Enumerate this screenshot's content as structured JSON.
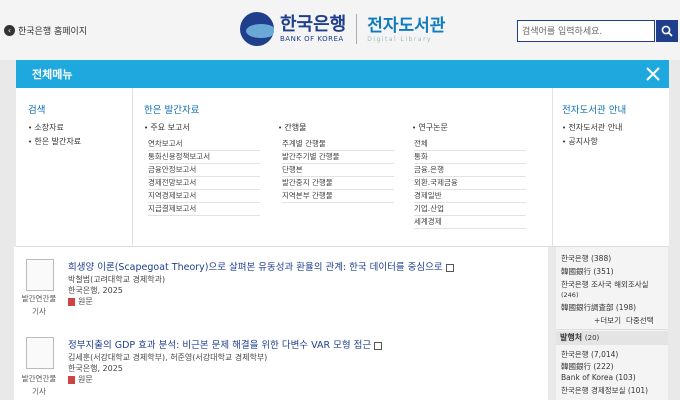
{
  "header": {
    "home_link": "한국은행 홈페이지",
    "logo_ko": "한국은행",
    "logo_en": "BANK OF KOREA",
    "library_ko": "전자도서관",
    "library_en": "Digital Library",
    "search_placeholder": "검색어를 입력하세요."
  },
  "menu": {
    "title": "전체메뉴",
    "search": {
      "title": "검색",
      "items": [
        "소장자료",
        "한은 발간자료"
      ]
    },
    "publications": {
      "title": "한은 발간자료",
      "groups": [
        {
          "label": "주요 보고서",
          "items": [
            "연차보고서",
            "통화신용정책보고서",
            "금융안정보고서",
            "경제전망보고서",
            "지역경제보고서",
            "지급결제보고서"
          ]
        },
        {
          "label": "간행물",
          "items": [
            "주계별 간행물",
            "발간주기별 간행물",
            "단행본",
            "발간중지 간행물",
            "지역본부 간행물"
          ]
        },
        {
          "label": "연구논문",
          "items": [
            "전체",
            "통화",
            "금융.은행",
            "외환.국제금융",
            "경제일반",
            "기업.산업",
            "세계경제"
          ]
        }
      ]
    },
    "library_info": {
      "title": "전자도서관 안내",
      "items": [
        "전자도서관 안내",
        "공지사항"
      ]
    }
  },
  "results": [
    {
      "thumb_label_1": "발간연간물",
      "thumb_label_2": "기사",
      "title": "희생양 이론(Scapegoat Theory)으로 살펴본 유동성과 환율의 관계: 한국 데이터를 중심으로",
      "authors": "박철범(고려대학교 경제학과)",
      "publisher": "한국은행, 2025",
      "original": "원문"
    },
    {
      "thumb_label_1": "발간연간물",
      "thumb_label_2": "기사",
      "title": "정부지출의 GDP 효과 분석: 비근본 문제 해결을 위한 다변수 VAR 모형 접근",
      "authors": "김세훈(서강대학교 경제학부), 허준영(서강대학교 경제학부)",
      "publisher": "한국은행, 2025",
      "original": "원문"
    }
  ],
  "sidebar": {
    "facet1": [
      "한국은행 (388)",
      "韓國銀行 (351)",
      "한국은행 조사국 해외조사실",
      "(246)",
      "韓國銀行調査部 (198)"
    ],
    "more": "+더보기",
    "multi_select": "다중선택",
    "publisher_head": "발행처",
    "publisher_count": "(20)",
    "publishers": [
      "한국은행 (7,014)",
      "韓國銀行 (222)",
      "Bank of Korea (103)",
      "한국은행 경제정보실 (101)"
    ]
  },
  "colors": {
    "brand": "#1f3f8c",
    "menu_bar": "#1fa8de",
    "accent_text": "#0f6fb0"
  }
}
